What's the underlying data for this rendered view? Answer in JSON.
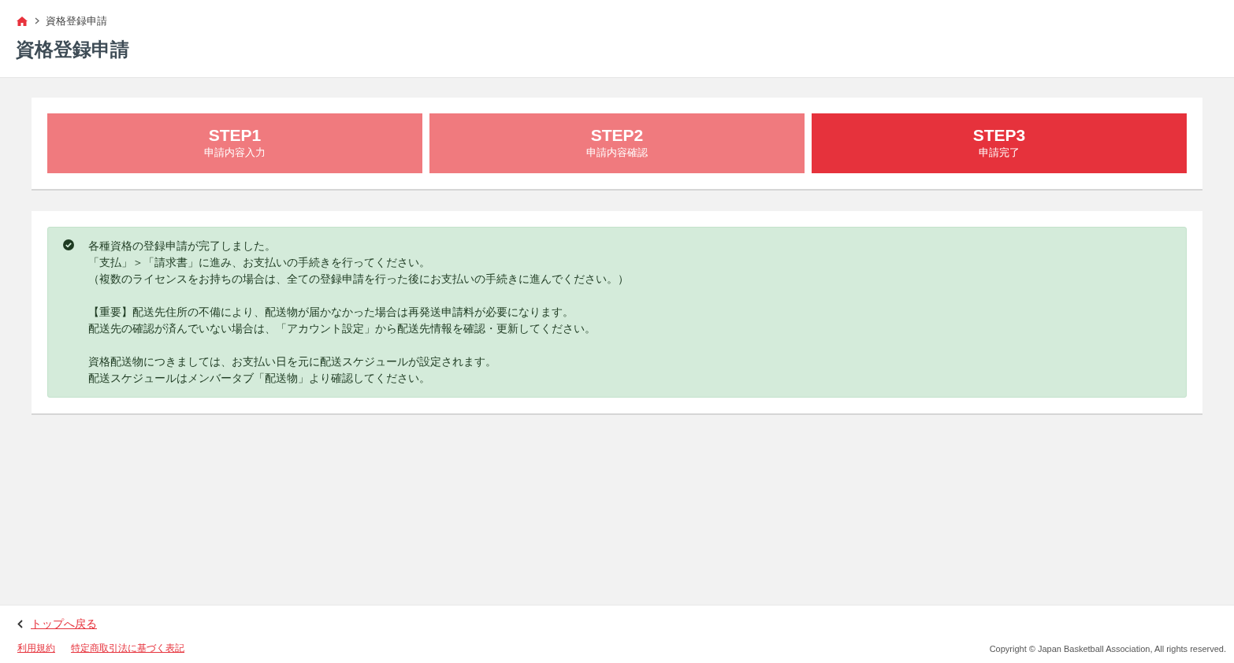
{
  "breadcrumb": {
    "items": [
      "資格登録申請"
    ]
  },
  "page_title": "資格登録申請",
  "steps": [
    {
      "label": "STEP1",
      "caption": "申請内容入力",
      "selected": false
    },
    {
      "label": "STEP2",
      "caption": "申請内容確認",
      "selected": false
    },
    {
      "label": "STEP3",
      "caption": "申請完了",
      "selected": true
    }
  ],
  "message": {
    "kind": "success",
    "paragraphs": [
      [
        "各種資格の登録申請が完了しました。",
        "「支払」＞「請求書」に進み、お支払いの手続きを行ってください。",
        "（複数のライセンスをお持ちの場合は、全ての登録申請を行った後にお支払いの手続きに進んでください。）"
      ],
      [
        "【重要】配送先住所の不備により、配送物が届かなかった場合は再発送申請料が必要になります。",
        "配送先の確認が済んでいない場合は、「アカウント設定」から配送先情報を確認・更新してください。"
      ],
      [
        "資格配送物につきましては、お支払い日を元に配送スケジュールが設定されます。",
        "配送スケジュールはメンバータブ「配送物」より確認してください。"
      ]
    ]
  },
  "footer": {
    "back_link": "トップへ戻る",
    "links": [
      "利用規約",
      "特定商取引法に基づく表記"
    ],
    "copyright": "Copyright © Japan Basketball Association, All rights reserved."
  }
}
